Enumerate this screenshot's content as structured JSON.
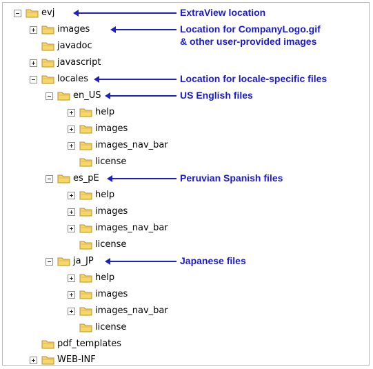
{
  "tree": {
    "items": [
      {
        "label": "evj",
        "toggle": "minus"
      },
      {
        "label": "images",
        "toggle": "plus"
      },
      {
        "label": "javadoc",
        "toggle": ""
      },
      {
        "label": "javascript",
        "toggle": "plus"
      },
      {
        "label": "locales",
        "toggle": "minus"
      },
      {
        "label": "en_US",
        "toggle": "minus"
      },
      {
        "label": "help",
        "toggle": "plus"
      },
      {
        "label": "images",
        "toggle": "plus"
      },
      {
        "label": "images_nav_bar",
        "toggle": "plus"
      },
      {
        "label": "license",
        "toggle": ""
      },
      {
        "label": "es_pE",
        "toggle": "minus"
      },
      {
        "label": "help",
        "toggle": "plus"
      },
      {
        "label": "images",
        "toggle": "plus"
      },
      {
        "label": "images_nav_bar",
        "toggle": "plus"
      },
      {
        "label": "license",
        "toggle": ""
      },
      {
        "label": "ja_JP",
        "toggle": "minus"
      },
      {
        "label": "help",
        "toggle": "plus"
      },
      {
        "label": "images",
        "toggle": "plus"
      },
      {
        "label": "images_nav_bar",
        "toggle": "plus"
      },
      {
        "label": "license",
        "toggle": ""
      },
      {
        "label": "pdf_templates",
        "toggle": ""
      },
      {
        "label": "WEB-INF",
        "toggle": "plus"
      }
    ]
  },
  "annotations": {
    "extraview_location": "ExtraView location",
    "logo_location_line1": "Location for CompanyLogo.gif",
    "logo_location_line2": "& other user-provided images",
    "locale_location": "Location for locale-specific files",
    "us_english": "US English files",
    "peruvian_spanish": "Peruvian Spanish files",
    "japanese": "Japanese files"
  },
  "colors": {
    "annotation": "#1a1ac8",
    "folder_fill": "#f6d66b",
    "folder_edge": "#b8902a"
  },
  "icons": {
    "folder": "folder-icon",
    "expand": "plus-box-icon",
    "collapse": "minus-box-icon",
    "pointer": "left-arrow-icon"
  }
}
